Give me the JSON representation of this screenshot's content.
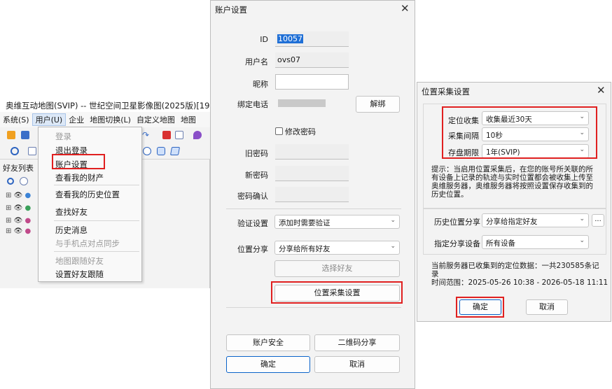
{
  "main_window": {
    "title": "奥维互动地图(SVIP) -- 世纪空间卫星影像图(2025版)[19]",
    "menu": [
      "系统(S)",
      "用户(U)",
      "企业",
      "地图切换(L)",
      "自定义地图",
      "地图"
    ],
    "friends_label": "好友列表"
  },
  "user_menu": {
    "items": [
      {
        "label": "登录",
        "disabled": true
      },
      {
        "label": "退出登录",
        "disabled": false
      },
      {
        "label": "账户设置",
        "disabled": false
      },
      {
        "label": "查看我的财产",
        "disabled": false
      },
      {
        "label": "查看我的历史位置",
        "disabled": false
      },
      {
        "label": "查找好友",
        "disabled": false
      },
      {
        "label": "历史消息",
        "disabled": false
      },
      {
        "label": "与手机点对点同步",
        "disabled": true
      },
      {
        "label": "地图跟随好友",
        "disabled": true
      },
      {
        "label": "设置好友跟随",
        "disabled": false
      }
    ]
  },
  "account_dialog": {
    "title": "账户设置",
    "close": "✕",
    "id_label": "ID",
    "id_value": "10057",
    "username_label": "用户名",
    "username_value": "ovs07",
    "nickname_label": "昵称",
    "nickname_value": "",
    "phone_label": "绑定电话",
    "unbind_button": "解绑",
    "change_password_label": "修改密码",
    "old_password_label": "旧密码",
    "new_password_label": "新密码",
    "confirm_password_label": "密码确认",
    "verify_label": "验证设置",
    "verify_value": "添加时需要验证",
    "share_label": "位置分享",
    "share_value": "分享给所有好友",
    "select_friends_button": "选择好友",
    "location_collect_button": "位置采集设置",
    "account_security_button": "账户安全",
    "qr_share_button": "二维码分享",
    "ok_button": "确定",
    "cancel_button": "取消"
  },
  "collect_dialog": {
    "title": "位置采集设置",
    "close": "✕",
    "collect_label": "定位收集",
    "collect_value": "收集最近30天",
    "interval_label": "采集间隔",
    "interval_value": "10秒",
    "storage_label": "存盘期限",
    "storage_value": "1年(SVIP)",
    "tip_lines": [
      "提示：当启用位置采集后，在您的账号所关联的所",
      "有设备上记录的轨迹与实时位置都会被收集上传至",
      "奥维服务器，奥维服务器将按照设置保存收集到的",
      "历史位置。"
    ],
    "history_share_label": "历史位置分享",
    "history_share_value": "分享给指定好友",
    "more_button": "...",
    "device_label": "指定分享设备",
    "device_value": "所有设备",
    "collected_lines": [
      "当前服务器已收集到的定位数据：一共230585条记",
      "录",
      "时间范围：2025-05-26 10:38 - 2026-05-18 11:11"
    ],
    "ok_button": "确定",
    "cancel_button": "取消"
  },
  "colors": {
    "highlight": "#e02020",
    "primary_border": "#0a63c9",
    "selection": "#1f6fd6"
  }
}
